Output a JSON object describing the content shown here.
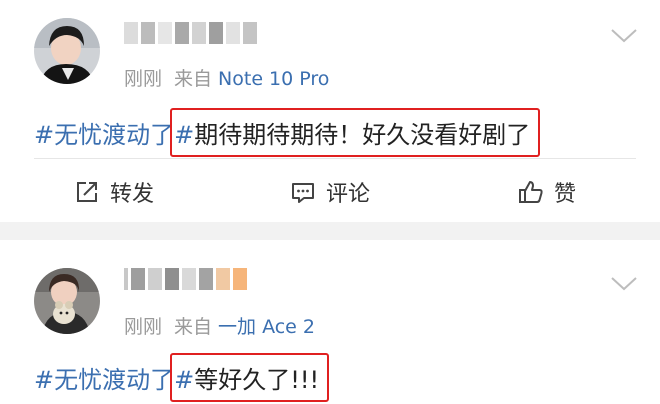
{
  "posts": [
    {
      "time": "刚刚",
      "source_prefix": "来自",
      "device": "Note 10 Pro",
      "topic": "#无忧渡动了",
      "hash_close": "#",
      "text": "期待期待期待！好久没看好剧了",
      "actions": {
        "repost": "转发",
        "comment": "评论",
        "like": "赞"
      }
    },
    {
      "time": "刚刚",
      "source_prefix": "来自",
      "device": "一加 Ace 2",
      "topic": "#无忧渡动了",
      "hash_close": "#",
      "text": "等好久了!!!"
    }
  ],
  "colors": {
    "link": "#3b6fb0",
    "highlight_box": "#e02020",
    "meta": "#9a9a9a"
  }
}
